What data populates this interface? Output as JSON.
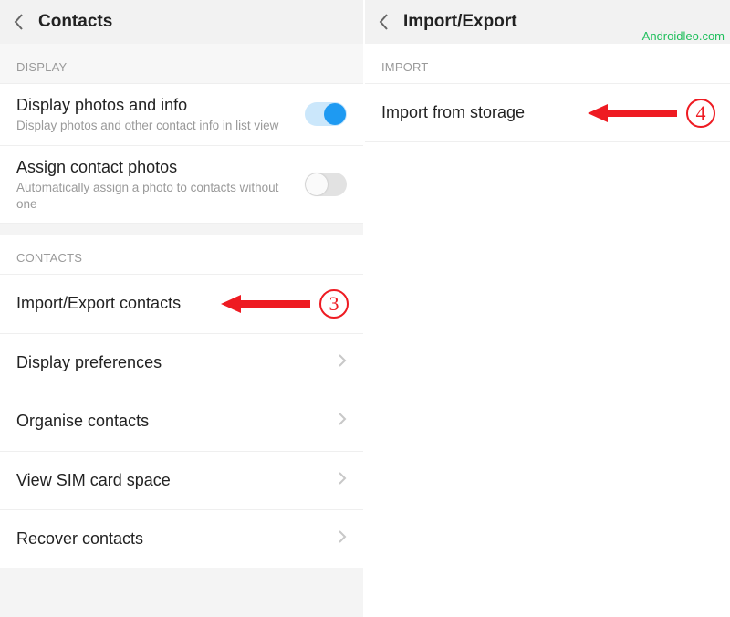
{
  "left": {
    "title": "Contacts",
    "section_display": "DISPLAY",
    "display_photos": {
      "title": "Display photos and info",
      "sub": "Display photos and other contact info in list view"
    },
    "assign_photos": {
      "title": "Assign contact photos",
      "sub": "Automatically assign a photo to contacts without one"
    },
    "section_contacts": "CONTACTS",
    "items": [
      {
        "label": "Import/Export contacts"
      },
      {
        "label": "Display preferences"
      },
      {
        "label": "Organise contacts"
      },
      {
        "label": "View SIM card space"
      },
      {
        "label": "Recover contacts"
      }
    ]
  },
  "right": {
    "title": "Import/Export",
    "section_import": "IMPORT",
    "import_storage": "Import from storage",
    "watermark": "Androidleo.com"
  },
  "annotations": {
    "n3": "3",
    "n4": "4"
  }
}
